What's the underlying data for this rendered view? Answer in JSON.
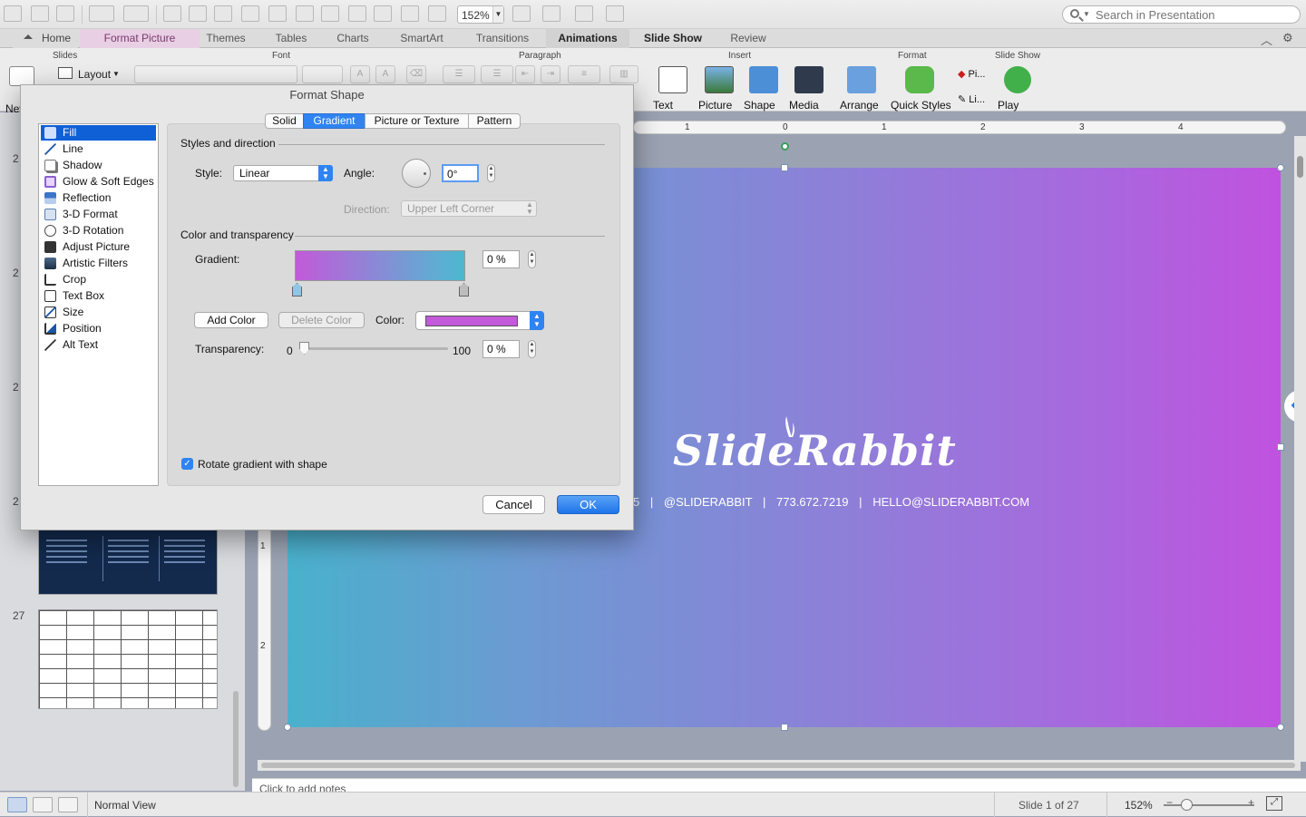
{
  "toolbar": {
    "zoom_value": "152%",
    "search_placeholder": "Search in Presentation"
  },
  "tabs": {
    "home": "Home",
    "format_picture": "Format Picture",
    "themes": "Themes",
    "tables": "Tables",
    "charts": "Charts",
    "smartart": "SmartArt",
    "transitions": "Transitions",
    "animations": "Animations",
    "slide_show": "Slide Show",
    "review": "Review"
  },
  "ribbon": {
    "groups": {
      "slides": "Slides",
      "font": "Font",
      "paragraph": "Paragraph",
      "insert": "Insert",
      "format": "Format",
      "slide_show": "Slide Show"
    },
    "new_label": "New",
    "layout_label": "Layout",
    "text": "Text",
    "picture": "Picture",
    "shape": "Shape",
    "media": "Media",
    "arrange": "Arrange",
    "quick_styles": "Quick Styles",
    "play": "Play",
    "fill_short": "Pi...",
    "line_short": "Li..."
  },
  "ruler": {
    "labels": [
      "1",
      "0",
      "1",
      "2",
      "3",
      "4"
    ],
    "v_labels": [
      "1",
      "2"
    ]
  },
  "thumbnails": {
    "partial_numbers": [
      "2",
      "2",
      "2",
      "2"
    ],
    "slide27_number": "27"
  },
  "slide": {
    "logo_text": "SlideRabbit",
    "contact_partial": "5",
    "contact_handle": "@SLIDERABBIT",
    "contact_phone": "773.672.7219",
    "contact_email": "HELLO@SLIDERABBIT.COM",
    "separator": "|",
    "gradient_colors": [
      "#49b1cc",
      "#c052df"
    ]
  },
  "notes_placeholder": "Click to add notes",
  "status": {
    "view_name": "Normal View",
    "slide_info": "Slide 1 of 27",
    "zoom": "152%"
  },
  "dialog": {
    "title": "Format Shape",
    "categories": [
      {
        "label": "Fill",
        "icon": "paint-bucket-icon",
        "selected": true
      },
      {
        "label": "Line",
        "icon": "line-icon"
      },
      {
        "label": "Shadow",
        "icon": "shadow-icon"
      },
      {
        "label": "Glow & Soft Edges",
        "icon": "glow-icon"
      },
      {
        "label": "Reflection",
        "icon": "reflection-icon"
      },
      {
        "label": "3-D Format",
        "icon": "3d-format-icon"
      },
      {
        "label": "3-D Rotation",
        "icon": "3d-rotation-icon"
      },
      {
        "label": "Adjust Picture",
        "icon": "adjust-picture-icon"
      },
      {
        "label": "Artistic Filters",
        "icon": "artistic-filters-icon"
      },
      {
        "label": "Crop",
        "icon": "crop-icon"
      },
      {
        "label": "Text Box",
        "icon": "text-box-icon"
      },
      {
        "label": "Size",
        "icon": "size-icon"
      },
      {
        "label": "Position",
        "icon": "position-icon"
      },
      {
        "label": "Alt Text",
        "icon": "alt-text-icon"
      }
    ],
    "fill_tabs": [
      "Solid",
      "Gradient",
      "Picture or Texture",
      "Pattern"
    ],
    "selected_fill_tab": "Gradient",
    "styles_section": "Styles and direction",
    "style_label": "Style:",
    "style_value": "Linear",
    "angle_label": "Angle:",
    "angle_value": "0°",
    "direction_label": "Direction:",
    "direction_value": "Upper Left Corner",
    "color_section": "Color and transparency",
    "gradient_label": "Gradient:",
    "gradient_position": "0 %",
    "add_color": "Add Color",
    "delete_color": "Delete Color",
    "color_label": "Color:",
    "selected_color": "#c25ad9",
    "transparency_label": "Transparency:",
    "transparency_min": "0",
    "transparency_max": "100",
    "transparency_value": "0 %",
    "transparency_level": 0,
    "rotate_label": "Rotate gradient with shape",
    "rotate_checked": true,
    "cancel": "Cancel",
    "ok": "OK"
  }
}
